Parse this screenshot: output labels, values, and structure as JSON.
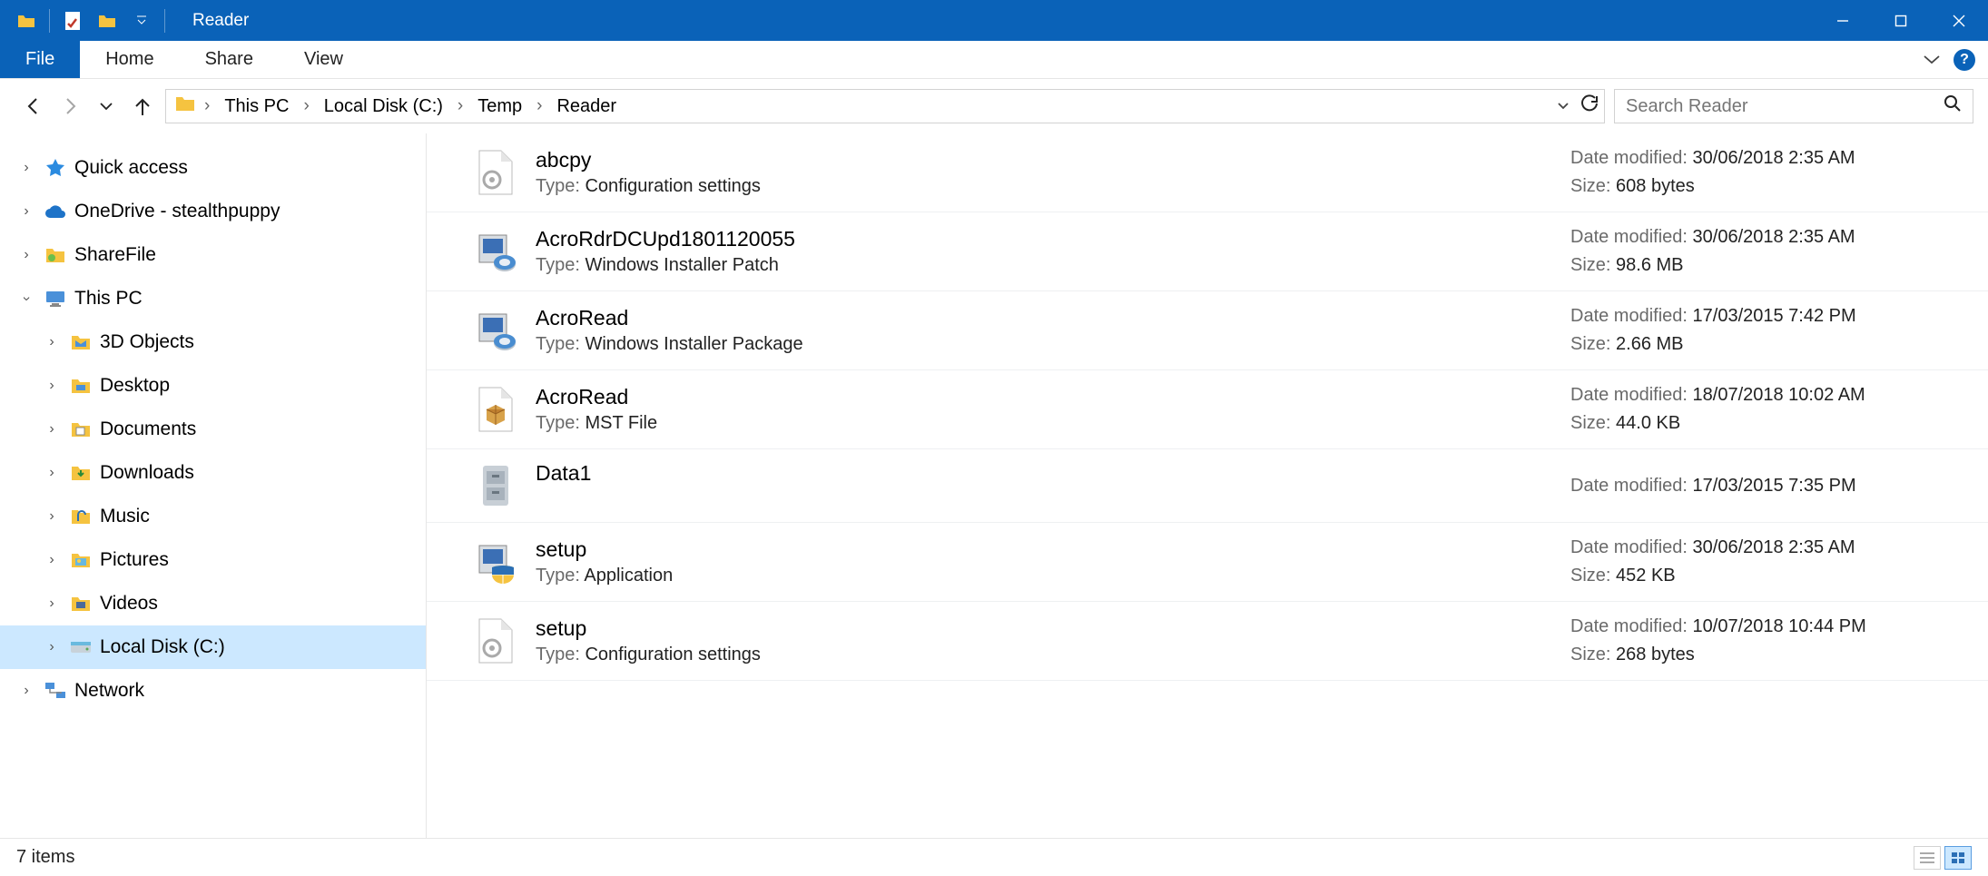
{
  "title": "Reader",
  "ribbon": {
    "tabs": [
      "File",
      "Home",
      "Share",
      "View"
    ]
  },
  "breadcrumb": [
    "This PC",
    "Local Disk (C:)",
    "Temp",
    "Reader"
  ],
  "search": {
    "placeholder": "Search Reader"
  },
  "nav": {
    "quick": "Quick access",
    "onedrive": "OneDrive - stealthpuppy",
    "sharefile": "ShareFile",
    "thispc": "This PC",
    "thispc_children": [
      "3D Objects",
      "Desktop",
      "Documents",
      "Downloads",
      "Music",
      "Pictures",
      "Videos",
      "Local Disk (C:)"
    ],
    "network": "Network"
  },
  "files": [
    {
      "name": "abcpy",
      "type": "Configuration settings",
      "date": "30/06/2018 2:35 AM",
      "size": "608 bytes",
      "icon": "gear-page"
    },
    {
      "name": "AcroRdrDCUpd1801120055",
      "type": "Windows Installer Patch",
      "date": "30/06/2018 2:35 AM",
      "size": "98.6 MB",
      "icon": "installer"
    },
    {
      "name": "AcroRead",
      "type": "Windows Installer Package",
      "date": "17/03/2015 7:42 PM",
      "size": "2.66 MB",
      "icon": "installer"
    },
    {
      "name": "AcroRead",
      "type": "MST File",
      "date": "18/07/2018 10:02 AM",
      "size": "44.0 KB",
      "icon": "box-page"
    },
    {
      "name": "Data1",
      "type": "",
      "date": "17/03/2015 7:35 PM",
      "size": "",
      "icon": "cabinet"
    },
    {
      "name": "setup",
      "type": "Application",
      "date": "30/06/2018 2:35 AM",
      "size": "452 KB",
      "icon": "installer-shield"
    },
    {
      "name": "setup",
      "type": "Configuration settings",
      "date": "10/07/2018 10:44 PM",
      "size": "268 bytes",
      "icon": "gear-page"
    }
  ],
  "labels": {
    "type": "Type:",
    "date": "Date modified:",
    "size": "Size:"
  },
  "status": {
    "count": "7 items"
  }
}
